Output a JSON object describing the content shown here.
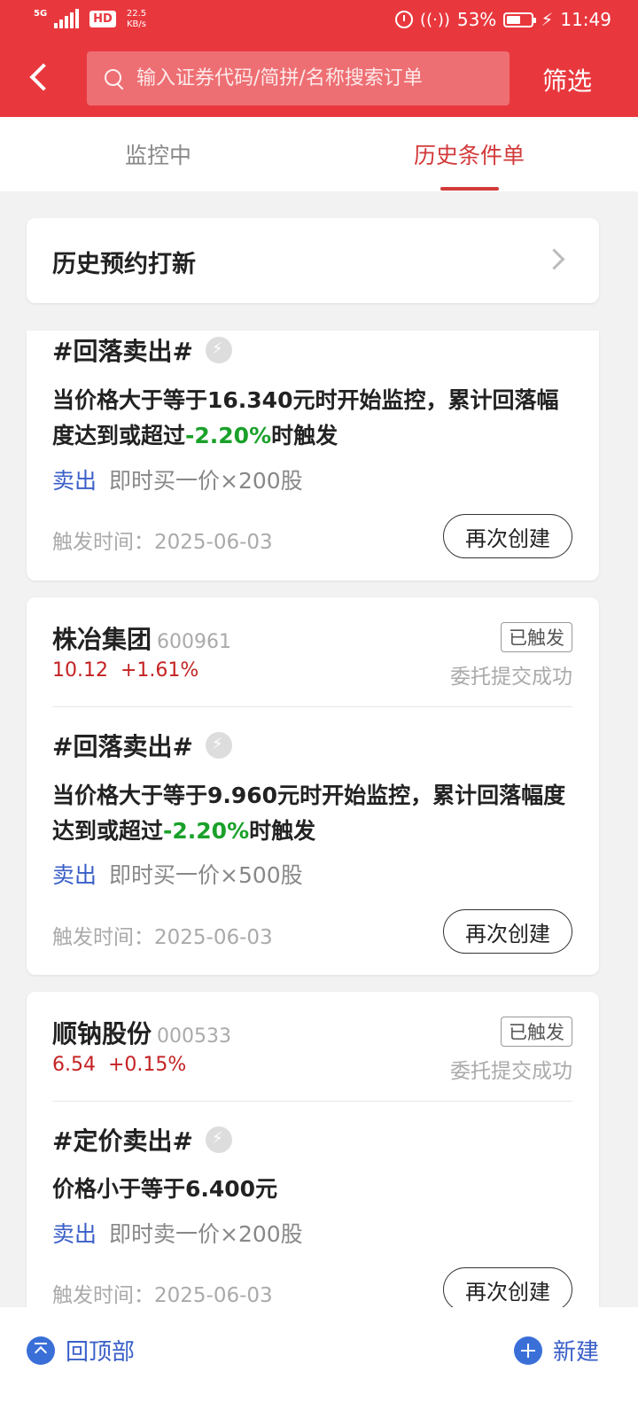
{
  "status_bar": {
    "network": "5G",
    "hd": "HD",
    "speed_value": "22.5",
    "speed_unit": "KB/s",
    "battery": "53%",
    "time": "11:49"
  },
  "header": {
    "search_placeholder": "输入证券代码/简拼/名称搜索订单",
    "filter_label": "筛选"
  },
  "tabs": [
    {
      "label": "监控中",
      "active": false
    },
    {
      "label": "历史条件单",
      "active": true
    }
  ],
  "history_ipo": {
    "label": "历史预约打新"
  },
  "orders": [
    {
      "type": "#回落卖出#",
      "cond_text": "当价格大于等于16.340元时开始监控，累计回落幅度达到或超过",
      "cond_value": "-2.20%",
      "cond_suffix": "时触发",
      "direction": "卖出",
      "detail": "即时买一价×200股",
      "trigger_time": "触发时间：2025-06-03",
      "button": "再次创建"
    },
    {
      "stock_name": "株冶集团",
      "stock_code": "600961",
      "price": "10.12",
      "change": "+1.61%",
      "badge": "已触发",
      "status": "委托提交成功",
      "type": "#回落卖出#",
      "cond_text": "当价格大于等于9.960元时开始监控，累计回落幅度达到或超过",
      "cond_value": "-2.20%",
      "cond_suffix": "时触发",
      "direction": "卖出",
      "detail": "即时买一价×500股",
      "trigger_time": "触发时间：2025-06-03",
      "button": "再次创建"
    },
    {
      "stock_name": "顺钠股份",
      "stock_code": "000533",
      "price": "6.54",
      "change": "+0.15%",
      "badge": "已触发",
      "status": "委托提交成功",
      "type": "#定价卖出#",
      "cond_text": "价格小于等于6.400元",
      "direction": "卖出",
      "detail": "即时卖一价×200股",
      "trigger_time": "触发时间：2025-06-03",
      "button": "再次创建"
    }
  ],
  "bottom": {
    "back_to_top": "回顶部",
    "new": "新建"
  },
  "colors": {
    "brand_red": "#e8383e",
    "accent_blue": "#3a5fc8",
    "trigger_green": "#1aa12a",
    "price_red": "#c42222"
  }
}
